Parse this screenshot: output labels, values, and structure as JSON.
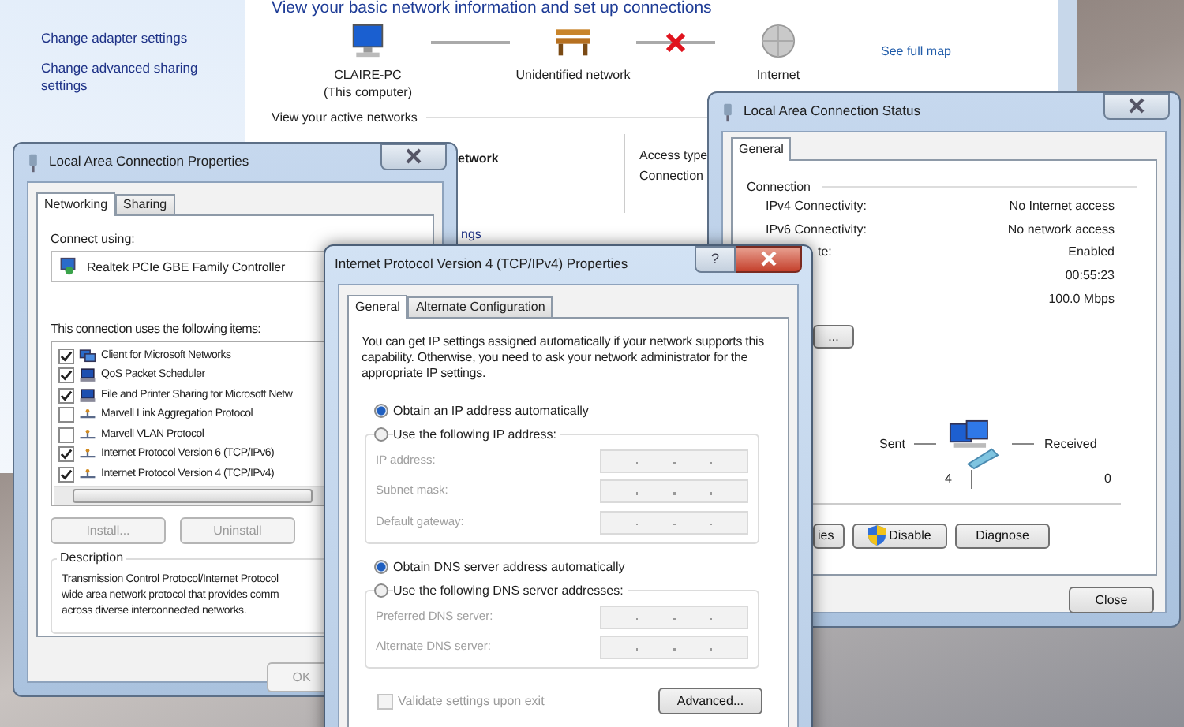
{
  "control_panel": {
    "sidebar_links": [
      "Change adapter settings",
      "Change advanced sharing settings"
    ],
    "heading": "View your basic network information and set up connections",
    "map": {
      "nodes": [
        {
          "kind": "computer",
          "name": "CLAIRE-PC",
          "subtitle": "(This computer)"
        },
        {
          "kind": "network",
          "name": "Unidentified network"
        },
        {
          "kind": "internet",
          "name": "Internet"
        }
      ],
      "links": [
        {
          "broken": false
        },
        {
          "broken": true
        }
      ]
    },
    "see_full_map": "See full map",
    "active_networks_heading": "View your active networks",
    "network_name": "etwork",
    "access_type_label": "Access type",
    "connections_label": "Connection",
    "cut_link": "ngs"
  },
  "properties_window": {
    "title": "Local Area Connection Properties",
    "tabs": [
      {
        "label": "Networking",
        "selected": true
      },
      {
        "label": "Sharing",
        "selected": false
      }
    ],
    "connect_using_label": "Connect using:",
    "adapter": "Realtek PCIe GBE Family Controller",
    "items_label": "This connection uses the following items:",
    "items": [
      {
        "label": "Client for Microsoft Networks",
        "checked": true,
        "kind": "client"
      },
      {
        "label": "QoS Packet Scheduler",
        "checked": true,
        "kind": "service"
      },
      {
        "label": "File and Printer Sharing for Microsoft Netw",
        "checked": true,
        "kind": "service"
      },
      {
        "label": "Marvell Link Aggregation Protocol",
        "checked": false,
        "kind": "protocol"
      },
      {
        "label": "Marvell VLAN Protocol",
        "checked": false,
        "kind": "protocol"
      },
      {
        "label": "Internet Protocol Version 6 (TCP/IPv6)",
        "checked": true,
        "kind": "protocol"
      },
      {
        "label": "Internet Protocol Version 4 (TCP/IPv4)",
        "checked": true,
        "kind": "protocol"
      }
    ],
    "buttons": [
      {
        "label": "Install...",
        "disabled": true
      },
      {
        "label": "Uninstall",
        "disabled": true
      }
    ],
    "description_title": "Description",
    "description_lines": [
      "Transmission Control Protocol/Internet Protocol",
      "wide area network protocol that provides comm",
      "across diverse interconnected networks."
    ],
    "ok": {
      "label": "OK",
      "disabled": true
    }
  },
  "status_window": {
    "title": "Local Area Connection Status",
    "tabs": [
      {
        "label": "General",
        "selected": true
      }
    ],
    "section": "Connection",
    "rows": [
      {
        "label": "IPv4 Connectivity:",
        "value": "No Internet access"
      },
      {
        "label": "IPv6 Connectivity:",
        "value": "No network access"
      },
      {
        "label": "te:",
        "value": "Enabled"
      },
      {
        "label": "",
        "value": "00:55:23"
      },
      {
        "label": "",
        "value": "100.0 Mbps"
      }
    ],
    "details_button": "...",
    "activity": {
      "sent_label": "Sent",
      "received_label": "Received",
      "sent": "4",
      "received": "0"
    },
    "buttons": [
      {
        "label": "ies",
        "kind": "plain"
      },
      {
        "label": "Disable",
        "kind": "shield"
      },
      {
        "label": "Diagnose",
        "kind": "plain"
      }
    ],
    "close": "Close"
  },
  "ipv4_window": {
    "title": "Internet Protocol Version 4 (TCP/IPv4) Properties",
    "help": "?",
    "tabs": [
      {
        "label": "General",
        "selected": true
      },
      {
        "label": "Alternate Configuration",
        "selected": false
      }
    ],
    "intro": "You can get IP settings assigned automatically if your network supports this capability. Otherwise, you need to ask your network administrator for the appropriate IP settings.",
    "ip_options": [
      {
        "label": "Obtain an IP address automatically",
        "selected": true
      },
      {
        "label": "Use the following IP address:",
        "selected": false
      }
    ],
    "ip_fields": [
      {
        "label": "IP address:",
        "disabled": true
      },
      {
        "label": "Subnet mask:",
        "disabled": true
      },
      {
        "label": "Default gateway:",
        "disabled": true
      }
    ],
    "dns_options": [
      {
        "label": "Obtain DNS server address automatically",
        "selected": true
      },
      {
        "label": "Use the following DNS server addresses:",
        "selected": false
      }
    ],
    "dns_fields": [
      {
        "label": "Preferred DNS server:",
        "disabled": true
      },
      {
        "label": "Alternate DNS server:",
        "disabled": true
      }
    ],
    "validate": {
      "label": "Validate settings upon exit",
      "checked": false,
      "disabled": true
    },
    "advanced": "Advanced..."
  }
}
